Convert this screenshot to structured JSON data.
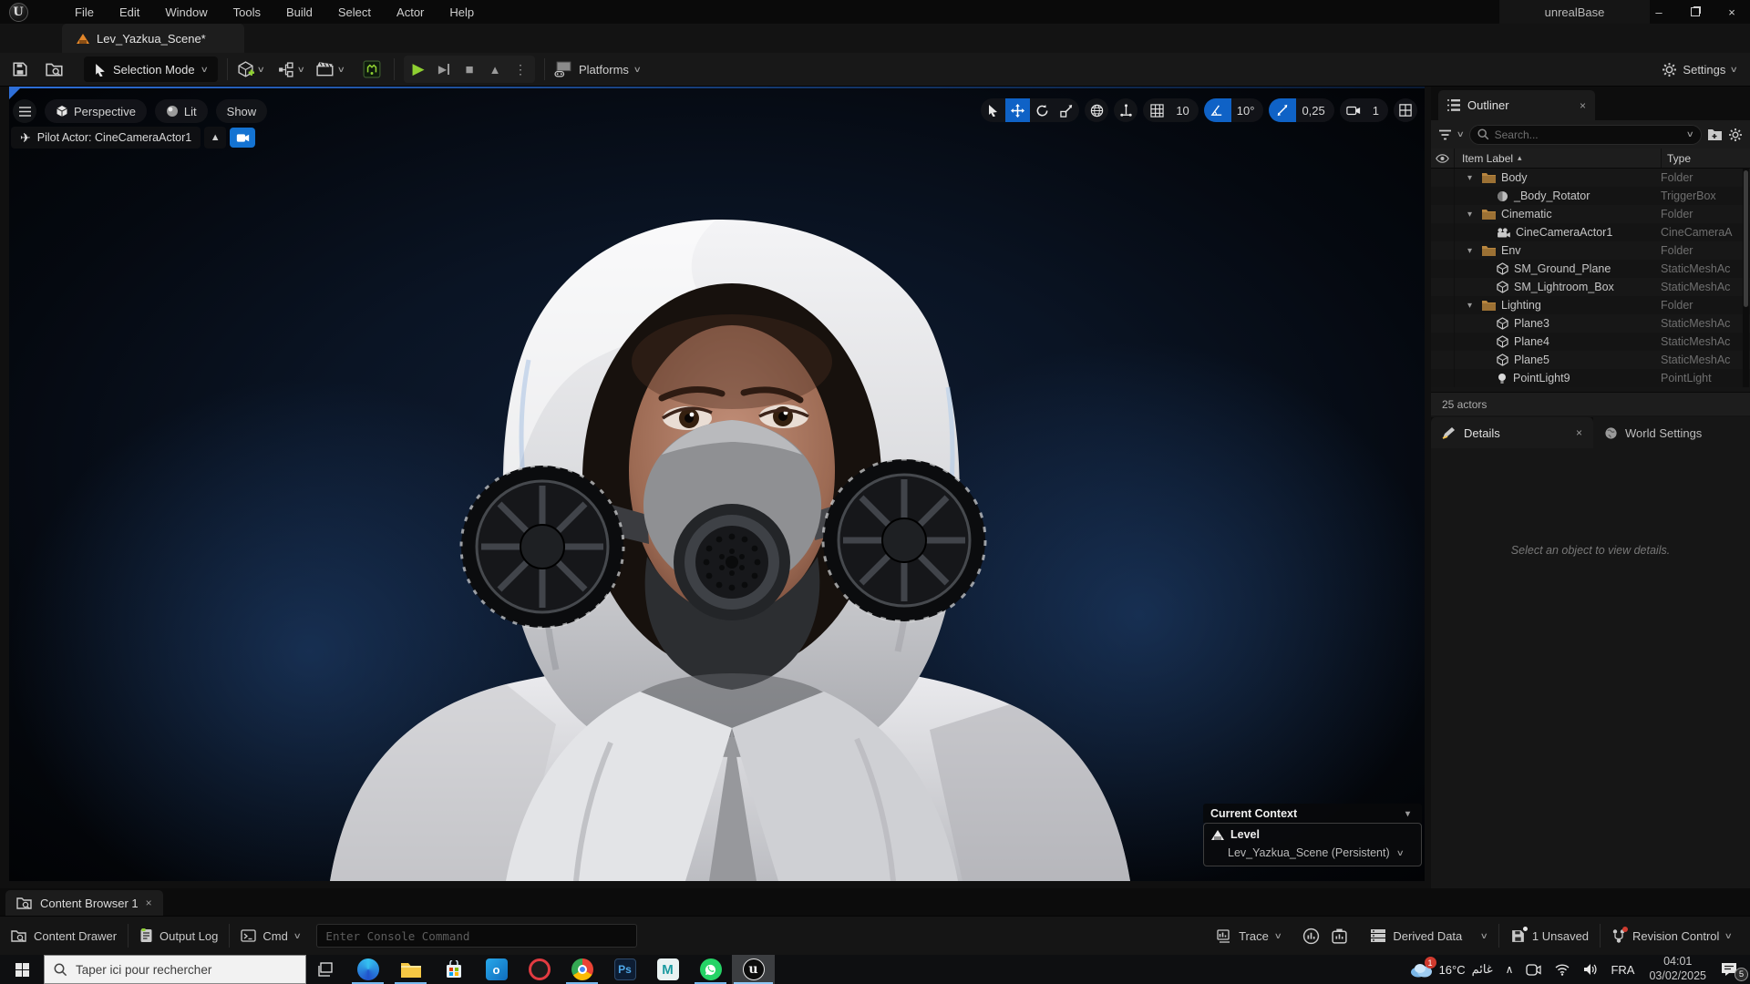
{
  "window": {
    "project_name": "unrealBase",
    "menus": [
      "File",
      "Edit",
      "Window",
      "Tools",
      "Build",
      "Select",
      "Actor",
      "Help"
    ],
    "scene_tab": "Lev_Yazkua_Scene*"
  },
  "toolbar": {
    "selection_mode_label": "Selection Mode",
    "platforms_label": "Platforms",
    "settings_label": "Settings"
  },
  "viewport": {
    "view_menu": {
      "perspective": "Perspective",
      "lit": "Lit",
      "show": "Show"
    },
    "pilot_label": "Pilot Actor: CineCameraActor1",
    "grid_snap": "10",
    "angle_snap": "10°",
    "scale_snap": "0,25",
    "camera_speed": "1",
    "current_context": {
      "title": "Current Context",
      "level_label": "Level",
      "level_value": "Lev_Yazkua_Scene (Persistent)"
    }
  },
  "outliner": {
    "tab_label": "Outliner",
    "search_placeholder": "Search...",
    "columns": {
      "item_label": "Item Label",
      "type": "Type"
    },
    "rows": [
      {
        "label": "Body",
        "type": "Folder",
        "icon": "folder-icon",
        "depth": 1
      },
      {
        "label": "_Body_Rotator",
        "type": "TriggerBox",
        "icon": "trigger-icon",
        "depth": 2
      },
      {
        "label": "Cinematic",
        "type": "Folder",
        "icon": "folder-icon",
        "depth": 1
      },
      {
        "label": "CineCameraActor1",
        "type": "CineCameraA",
        "icon": "cine-camera-icon",
        "depth": 2
      },
      {
        "label": "Env",
        "type": "Folder",
        "icon": "folder-icon",
        "depth": 1
      },
      {
        "label": "SM_Ground_Plane",
        "type": "StaticMeshAc",
        "icon": "static-mesh-icon",
        "depth": 2
      },
      {
        "label": "SM_Lightroom_Box",
        "type": "StaticMeshAc",
        "icon": "static-mesh-icon",
        "depth": 2
      },
      {
        "label": "Lighting",
        "type": "Folder",
        "icon": "folder-icon",
        "depth": 1
      },
      {
        "label": "Plane3",
        "type": "StaticMeshAc",
        "icon": "static-mesh-icon",
        "depth": 2
      },
      {
        "label": "Plane4",
        "type": "StaticMeshAc",
        "icon": "static-mesh-icon",
        "depth": 2
      },
      {
        "label": "Plane5",
        "type": "StaticMeshAc",
        "icon": "static-mesh-icon",
        "depth": 2
      },
      {
        "label": "PointLight9",
        "type": "PointLight",
        "icon": "point-light-icon",
        "depth": 2
      }
    ],
    "footer": "25 actors"
  },
  "details_panel": {
    "details_tab": "Details",
    "world_settings_tab": "World Settings",
    "empty_message": "Select an object to view details."
  },
  "content_browser": {
    "tab_label": "Content Browser 1"
  },
  "statusbar": {
    "content_drawer": "Content Drawer",
    "output_log": "Output Log",
    "cmd_label": "Cmd",
    "console_placeholder": "Enter Console Command",
    "trace_label": "Trace",
    "derived_data_label": "Derived Data",
    "unsaved_label": "1 Unsaved",
    "revision_control_label": "Revision Control"
  },
  "taskbar": {
    "search_placeholder": "Taper ici pour rechercher",
    "temperature": "16°C",
    "weather_condition": "غائم",
    "weather_badge": "1",
    "language": "FRA",
    "time": "04:01",
    "date": "03/02/2025",
    "notification_count": "5",
    "app_photoshop": "Ps",
    "app_maya": "M",
    "app_outlook": "o",
    "app_opera": "O",
    "app_unreal": "u"
  },
  "icons": {
    "chevron_down": "∨",
    "expand_caret": "▾",
    "caret_down_filled": "▾",
    "sort_asc": "▴",
    "play": "▶",
    "skip": "▶",
    "stop": "■",
    "eject": "▲",
    "kebab": "⋮",
    "close": "×",
    "minimize": "–",
    "pilot_plane": "✈",
    "hidden_icons": "∧"
  },
  "colors": {
    "accent_blue": "#0f62c6",
    "play_green": "#8fd032",
    "folder_orange": "#b8863f",
    "tab_icon_orange": "#e2862a",
    "taskbar_underline": "#76b9ed"
  }
}
